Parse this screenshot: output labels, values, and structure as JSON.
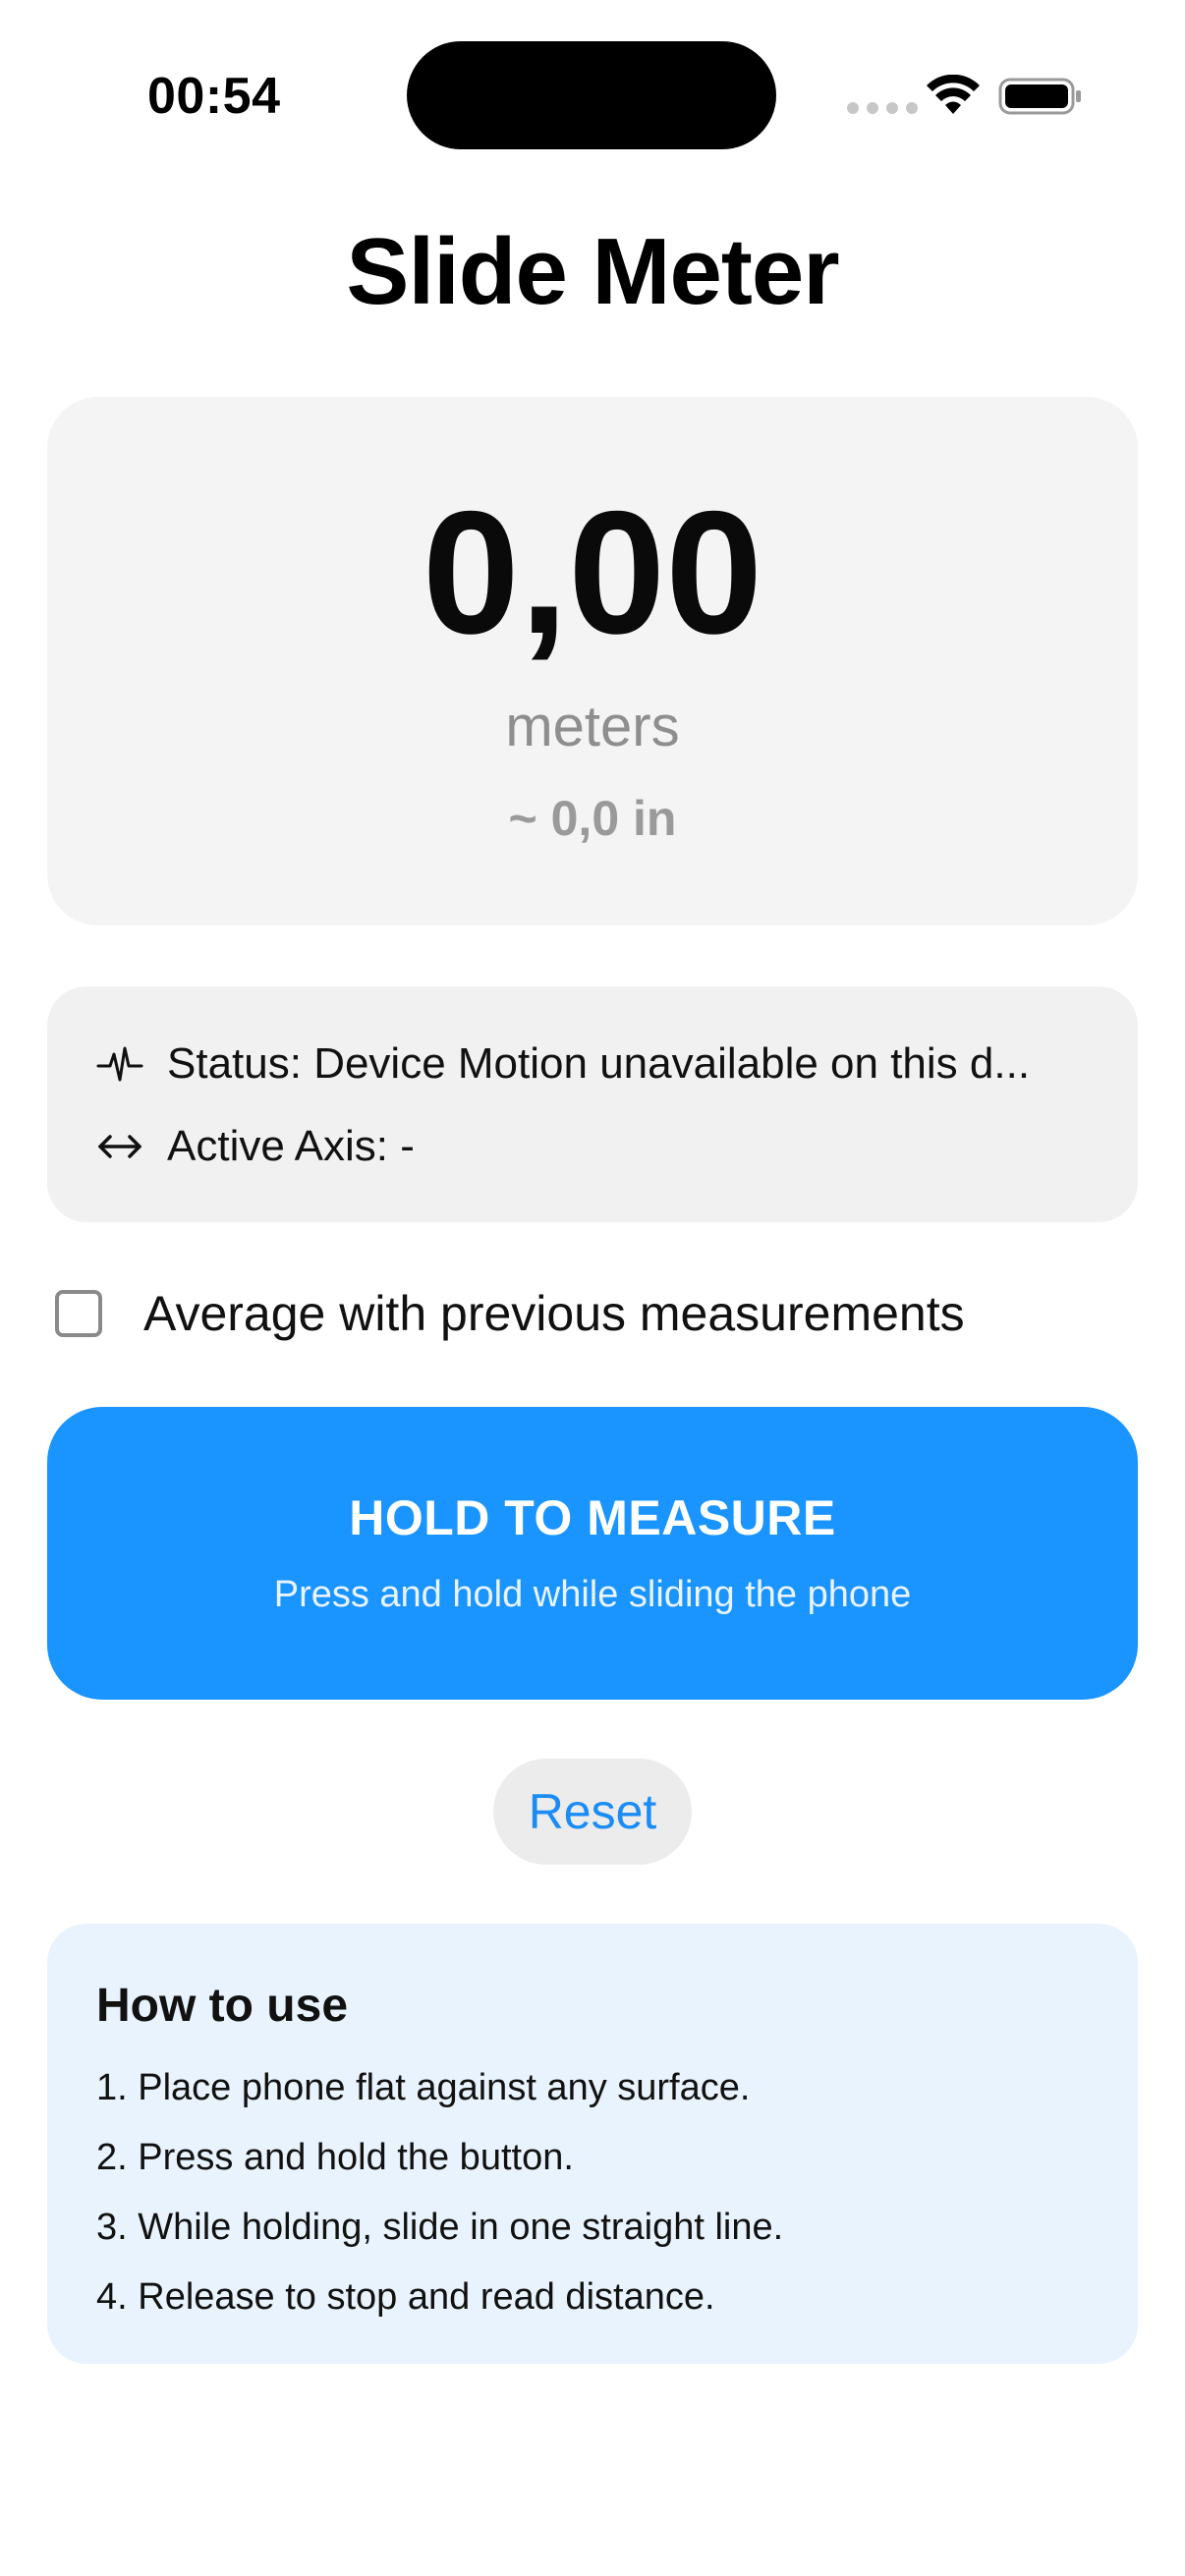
{
  "status_bar": {
    "time": "00:54"
  },
  "page": {
    "title": "Slide Meter"
  },
  "measurement": {
    "value": "0,00",
    "unit": "meters",
    "inches": "~ 0,0 in"
  },
  "status": {
    "status_text": "Status: Device Motion unavailable on this d...",
    "axis_text": "Active Axis: -"
  },
  "average": {
    "label": "Average with previous measurements",
    "checked": false
  },
  "hold_button": {
    "title": "HOLD TO MEASURE",
    "subtitle": "Press and hold while sliding the phone"
  },
  "reset_button": {
    "label": "Reset"
  },
  "how_to": {
    "title": "How to use",
    "steps": [
      "1. Place phone flat against any surface.",
      "2. Press and hold the button.",
      "3. While holding, slide in one straight line.",
      "4. Release to stop and read distance."
    ]
  },
  "colors": {
    "accent": "#1a94fe",
    "link": "#1a8cf5",
    "card_bg": "#f4f4f4",
    "info_bg": "#e9f3fd"
  },
  "icons": {
    "status_row": "waveform-icon",
    "axis_row": "left-right-arrow-icon",
    "signal": "cellular-signal-icon",
    "wifi": "wifi-icon",
    "battery": "battery-icon"
  }
}
